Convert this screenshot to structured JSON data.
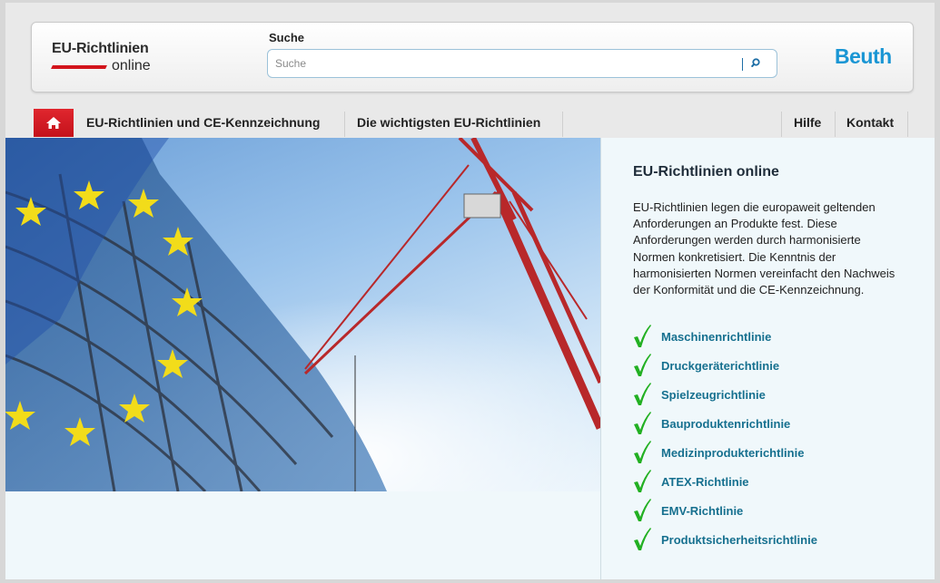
{
  "header": {
    "logo_title": "EU-Richtlinien",
    "logo_subtitle": "online",
    "search_label": "Suche",
    "search_placeholder": "Suche",
    "search_value": "",
    "brand": "Beuth"
  },
  "nav": {
    "home_icon": "home-icon",
    "items": [
      {
        "label": "EU-Richtlinien und CE-Kennzeichnung"
      },
      {
        "label": "Die wichtigsten EU-Richtlinien"
      }
    ],
    "right_items": [
      {
        "label": "Hilfe"
      },
      {
        "label": "Kontakt"
      }
    ]
  },
  "sidebar": {
    "title": "EU-Richtlinien online",
    "description": "EU-Richtlinien legen die europaweit geltenden Anforderungen an Produkte fest. Diese Anforderungen werden durch harmonisierte Normen konkretisiert. Die Kenntnis der harmonisierten Normen vereinfacht den Nachweis der Konformität und die CE-Kennzeichnung.",
    "links": [
      {
        "label": "Maschinenrichtlinie"
      },
      {
        "label": "Druckgeräterichtlinie"
      },
      {
        "label": "Spielzeugrichtlinie"
      },
      {
        "label": "Bauproduktenrichtlinie"
      },
      {
        "label": "Medizinprodukterichtlinie"
      },
      {
        "label": "ATEX-Richtlinie"
      },
      {
        "label": "EMV-Richtlinie"
      },
      {
        "label": "Produktsicherheitsrichtlinie"
      }
    ]
  },
  "colors": {
    "accent_red": "#d2141c",
    "brand_blue": "#1a96d4",
    "link_teal": "#16708f",
    "check_green": "#22b022"
  }
}
